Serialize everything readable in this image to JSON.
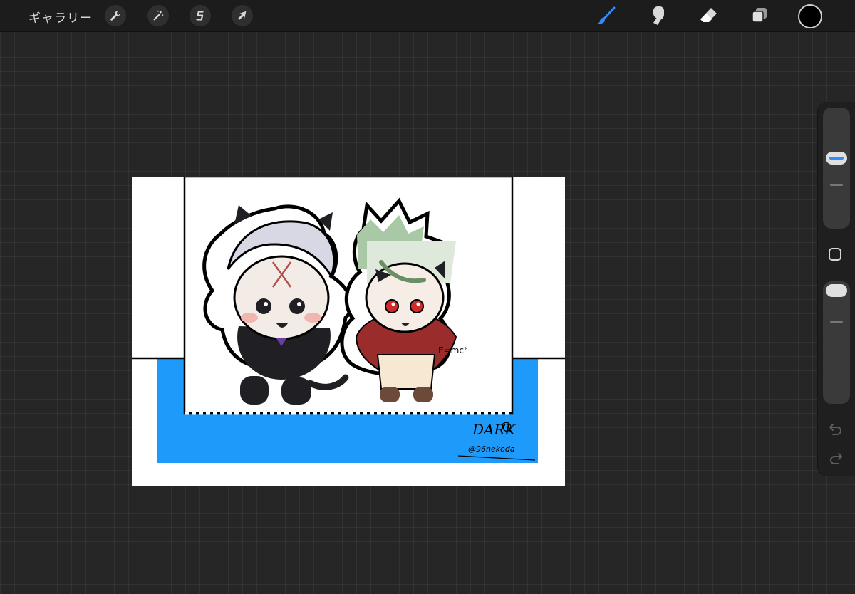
{
  "toolbar": {
    "gallery_label": "ギャラリー",
    "left_tools": [
      {
        "name": "actions",
        "icon": "wrench-icon"
      },
      {
        "name": "adjustments",
        "icon": "magic-wand-icon"
      },
      {
        "name": "selection",
        "icon": "selection-s-icon"
      },
      {
        "name": "transform",
        "icon": "arrow-cursor-icon"
      }
    ],
    "right_tools": [
      {
        "name": "brush",
        "icon": "brush-icon",
        "active": true
      },
      {
        "name": "smudge",
        "icon": "smudge-finger-icon",
        "active": false
      },
      {
        "name": "eraser",
        "icon": "eraser-icon",
        "active": false
      },
      {
        "name": "layers",
        "icon": "layers-icon",
        "active": false
      }
    ],
    "current_color": "#000000",
    "accent_color": "#2f8cff"
  },
  "sidebar": {
    "brush_size_level": 0.6,
    "opacity_level": 0.0,
    "undo_icon": "undo-icon",
    "redo_icon": "redo-icon"
  },
  "canvas": {
    "background_color": "#ffffff",
    "frame_fill_color": "#1e9bfa",
    "formula_text": "E=mc²",
    "signature_handle": "@96nekoda",
    "signature_name": "DARK"
  }
}
